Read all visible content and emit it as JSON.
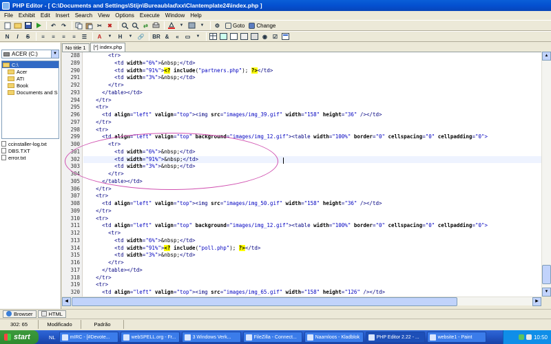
{
  "window": {
    "title": "PHP Editor - [ C:\\Documents and Settings\\Stijn\\Bureaublad\\xx\\Clantemplate24\\index.php ]"
  },
  "menu": [
    "File",
    "Exhibit",
    "Edit",
    "Insert",
    "Search",
    "View",
    "Options",
    "Execute",
    "Window",
    "Help"
  ],
  "toolbar1": {
    "goto_label": "Goto",
    "change_label": "Change"
  },
  "toolbar2": {
    "bold": "N",
    "italic": "I",
    "strike": "S",
    "heading": "H",
    "br": "BR",
    "nbsp": "&"
  },
  "left_panel": {
    "drive": "ACER (C:)",
    "folders": [
      {
        "label": "C:\\",
        "selected": true
      },
      {
        "label": "Acer",
        "selected": false
      },
      {
        "label": "ATI",
        "selected": false
      },
      {
        "label": "Book",
        "selected": false
      },
      {
        "label": "Documents and S",
        "selected": false
      }
    ],
    "files": [
      "ccinstaller-log.txt",
      "DBS.TXT",
      "error.txt"
    ]
  },
  "tabs": [
    {
      "label": "No title 1",
      "active": false
    },
    {
      "label": "[*] index.php",
      "active": true
    }
  ],
  "editor": {
    "current_line": 302,
    "lines": [
      {
        "n": "288",
        "i": 8,
        "p": [
          [
            "tag",
            "<tr>"
          ]
        ]
      },
      {
        "n": "289",
        "i": 10,
        "p": [
          [
            "tag",
            "<td "
          ],
          [
            "attr",
            "width"
          ],
          [
            "tag",
            "="
          ],
          [
            "str",
            "\"6%\""
          ],
          [
            "tag",
            ">"
          ],
          [
            "plain",
            "&nbsp;"
          ],
          [
            "tag",
            "</td>"
          ]
        ]
      },
      {
        "n": "290",
        "i": 10,
        "p": [
          [
            "tag",
            "<td "
          ],
          [
            "attr",
            "width"
          ],
          [
            "tag",
            "="
          ],
          [
            "str",
            "\"91%\""
          ],
          [
            "tag",
            ">"
          ],
          [
            "php",
            "<?"
          ],
          [
            "plain",
            " "
          ],
          [
            "kw",
            "include"
          ],
          [
            "plain",
            "("
          ],
          [
            "str",
            "\"partners.php\""
          ],
          [
            "plain",
            "); "
          ],
          [
            "php",
            "?>"
          ],
          [
            "tag",
            "</td>"
          ]
        ]
      },
      {
        "n": "291",
        "i": 10,
        "p": [
          [
            "tag",
            "<td "
          ],
          [
            "attr",
            "width"
          ],
          [
            "tag",
            "="
          ],
          [
            "str",
            "\"3%\""
          ],
          [
            "tag",
            ">"
          ],
          [
            "plain",
            "&nbsp;"
          ],
          [
            "tag",
            "</td>"
          ]
        ]
      },
      {
        "n": "292",
        "i": 8,
        "p": [
          [
            "tag",
            "</tr>"
          ]
        ]
      },
      {
        "n": "293",
        "i": 6,
        "p": [
          [
            "tag",
            "</table></td>"
          ]
        ]
      },
      {
        "n": "294",
        "i": 4,
        "p": [
          [
            "tag",
            "</tr>"
          ]
        ]
      },
      {
        "n": "295",
        "i": 4,
        "p": [
          [
            "tag",
            "<tr>"
          ]
        ]
      },
      {
        "n": "296",
        "i": 6,
        "p": [
          [
            "tag",
            "<td "
          ],
          [
            "attr",
            "align"
          ],
          [
            "tag",
            "="
          ],
          [
            "str",
            "\"left\""
          ],
          [
            "plain",
            " "
          ],
          [
            "attr",
            "valign"
          ],
          [
            "tag",
            "="
          ],
          [
            "str",
            "\"top\""
          ],
          [
            "tag",
            "><img "
          ],
          [
            "attr",
            "src"
          ],
          [
            "tag",
            "="
          ],
          [
            "str",
            "\"images/img_39.gif\""
          ],
          [
            "plain",
            " "
          ],
          [
            "attr",
            "width"
          ],
          [
            "tag",
            "="
          ],
          [
            "str",
            "\"158\""
          ],
          [
            "plain",
            " "
          ],
          [
            "attr",
            "height"
          ],
          [
            "tag",
            "="
          ],
          [
            "str",
            "\"36\""
          ],
          [
            "tag",
            " /></td>"
          ]
        ]
      },
      {
        "n": "297",
        "i": 4,
        "p": [
          [
            "tag",
            "</tr>"
          ]
        ]
      },
      {
        "n": "298",
        "i": 4,
        "p": [
          [
            "tag",
            "<tr>"
          ]
        ]
      },
      {
        "n": "299",
        "i": 6,
        "p": [
          [
            "tag",
            "<td "
          ],
          [
            "attr",
            "align"
          ],
          [
            "tag",
            "="
          ],
          [
            "str",
            "\"left\""
          ],
          [
            "plain",
            " "
          ],
          [
            "attr",
            "valign"
          ],
          [
            "tag",
            "="
          ],
          [
            "str",
            "\"top\""
          ],
          [
            "plain",
            " "
          ],
          [
            "attr",
            "background"
          ],
          [
            "tag",
            "="
          ],
          [
            "str",
            "\"images/img_12.gif\""
          ],
          [
            "tag",
            "><table "
          ],
          [
            "attr",
            "width"
          ],
          [
            "tag",
            "="
          ],
          [
            "str",
            "\"100%\""
          ],
          [
            "plain",
            " "
          ],
          [
            "attr",
            "border"
          ],
          [
            "tag",
            "="
          ],
          [
            "str",
            "\"0\""
          ],
          [
            "plain",
            " "
          ],
          [
            "attr",
            "cellspacing"
          ],
          [
            "tag",
            "="
          ],
          [
            "str",
            "\"0\""
          ],
          [
            "plain",
            " "
          ],
          [
            "attr",
            "cellpadding"
          ],
          [
            "tag",
            "="
          ],
          [
            "str",
            "\"0\">"
          ]
        ]
      },
      {
        "n": "300",
        "i": 8,
        "p": [
          [
            "tag",
            "<tr>"
          ]
        ]
      },
      {
        "n": "301",
        "i": 10,
        "p": [
          [
            "tag",
            "<td "
          ],
          [
            "attr",
            "width"
          ],
          [
            "tag",
            "="
          ],
          [
            "str",
            "\"6%\""
          ],
          [
            "tag",
            ">"
          ],
          [
            "plain",
            "&nbsp;"
          ],
          [
            "tag",
            "</td>"
          ]
        ]
      },
      {
        "n": "302",
        "i": 10,
        "p": [
          [
            "tag",
            "<td "
          ],
          [
            "attr",
            "width"
          ],
          [
            "tag",
            "="
          ],
          [
            "str",
            "\"91%\""
          ],
          [
            "tag",
            ">"
          ],
          [
            "plain",
            "&nbsp;"
          ],
          [
            "tag",
            "</td>"
          ]
        ]
      },
      {
        "n": "303",
        "i": 10,
        "p": [
          [
            "tag",
            "<td "
          ],
          [
            "attr",
            "width"
          ],
          [
            "tag",
            "="
          ],
          [
            "str",
            "\"3%\""
          ],
          [
            "tag",
            ">"
          ],
          [
            "plain",
            "&nbsp;"
          ],
          [
            "tag",
            "</td>"
          ]
        ]
      },
      {
        "n": "304",
        "i": 8,
        "p": [
          [
            "tag",
            "</tr>"
          ]
        ]
      },
      {
        "n": "305",
        "i": 6,
        "p": [
          [
            "tag",
            "</table></td>"
          ]
        ]
      },
      {
        "n": "306",
        "i": 4,
        "p": [
          [
            "tag",
            "</tr>"
          ]
        ]
      },
      {
        "n": "307",
        "i": 4,
        "p": [
          [
            "tag",
            "<tr>"
          ]
        ]
      },
      {
        "n": "308",
        "i": 6,
        "p": [
          [
            "tag",
            "<td "
          ],
          [
            "attr",
            "align"
          ],
          [
            "tag",
            "="
          ],
          [
            "str",
            "\"left\""
          ],
          [
            "plain",
            " "
          ],
          [
            "attr",
            "valign"
          ],
          [
            "tag",
            "="
          ],
          [
            "str",
            "\"top\""
          ],
          [
            "tag",
            "><img "
          ],
          [
            "attr",
            "src"
          ],
          [
            "tag",
            "="
          ],
          [
            "str",
            "\"images/img_50.gif\""
          ],
          [
            "plain",
            " "
          ],
          [
            "attr",
            "width"
          ],
          [
            "tag",
            "="
          ],
          [
            "str",
            "\"158\""
          ],
          [
            "plain",
            " "
          ],
          [
            "attr",
            "height"
          ],
          [
            "tag",
            "="
          ],
          [
            "str",
            "\"36\""
          ],
          [
            "tag",
            " /></td>"
          ]
        ]
      },
      {
        "n": "309",
        "i": 4,
        "p": [
          [
            "tag",
            "</tr>"
          ]
        ]
      },
      {
        "n": "310",
        "i": 4,
        "p": [
          [
            "tag",
            "<tr>"
          ]
        ]
      },
      {
        "n": "311",
        "i": 6,
        "p": [
          [
            "tag",
            "<td "
          ],
          [
            "attr",
            "align"
          ],
          [
            "tag",
            "="
          ],
          [
            "str",
            "\"left\""
          ],
          [
            "plain",
            " "
          ],
          [
            "attr",
            "valign"
          ],
          [
            "tag",
            "="
          ],
          [
            "str",
            "\"top\""
          ],
          [
            "plain",
            " "
          ],
          [
            "attr",
            "background"
          ],
          [
            "tag",
            "="
          ],
          [
            "str",
            "\"images/img_12.gif\""
          ],
          [
            "tag",
            "><table "
          ],
          [
            "attr",
            "width"
          ],
          [
            "tag",
            "="
          ],
          [
            "str",
            "\"100%\""
          ],
          [
            "plain",
            " "
          ],
          [
            "attr",
            "border"
          ],
          [
            "tag",
            "="
          ],
          [
            "str",
            "\"0\""
          ],
          [
            "plain",
            " "
          ],
          [
            "attr",
            "cellspacing"
          ],
          [
            "tag",
            "="
          ],
          [
            "str",
            "\"0\""
          ],
          [
            "plain",
            " "
          ],
          [
            "attr",
            "cellpadding"
          ],
          [
            "tag",
            "="
          ],
          [
            "str",
            "\"0\">"
          ]
        ]
      },
      {
        "n": "312",
        "i": 8,
        "p": [
          [
            "tag",
            "<tr>"
          ]
        ]
      },
      {
        "n": "313",
        "i": 10,
        "p": [
          [
            "tag",
            "<td "
          ],
          [
            "attr",
            "width"
          ],
          [
            "tag",
            "="
          ],
          [
            "str",
            "\"6%\""
          ],
          [
            "tag",
            ">"
          ],
          [
            "plain",
            "&nbsp;"
          ],
          [
            "tag",
            "</td>"
          ]
        ]
      },
      {
        "n": "314",
        "i": 10,
        "p": [
          [
            "tag",
            "<td "
          ],
          [
            "attr",
            "width"
          ],
          [
            "tag",
            "="
          ],
          [
            "str",
            "\"91%\""
          ],
          [
            "tag",
            ">"
          ],
          [
            "php",
            "<?"
          ],
          [
            "plain",
            " "
          ],
          [
            "kw",
            "include"
          ],
          [
            "plain",
            "("
          ],
          [
            "str",
            "\"poll.php\""
          ],
          [
            "plain",
            "); "
          ],
          [
            "php",
            "?>"
          ],
          [
            "tag",
            "</td>"
          ]
        ]
      },
      {
        "n": "315",
        "i": 10,
        "p": [
          [
            "tag",
            "<td "
          ],
          [
            "attr",
            "width"
          ],
          [
            "tag",
            "="
          ],
          [
            "str",
            "\"3%\""
          ],
          [
            "tag",
            ">"
          ],
          [
            "plain",
            "&nbsp;"
          ],
          [
            "tag",
            "</td>"
          ]
        ]
      },
      {
        "n": "316",
        "i": 8,
        "p": [
          [
            "tag",
            "</tr>"
          ]
        ]
      },
      {
        "n": "317",
        "i": 6,
        "p": [
          [
            "tag",
            "</table></td>"
          ]
        ]
      },
      {
        "n": "318",
        "i": 4,
        "p": [
          [
            "tag",
            "</tr>"
          ]
        ]
      },
      {
        "n": "319",
        "i": 4,
        "p": [
          [
            "tag",
            "<tr>"
          ]
        ]
      },
      {
        "n": "320",
        "i": 6,
        "p": [
          [
            "tag",
            "<td "
          ],
          [
            "attr",
            "align"
          ],
          [
            "tag",
            "="
          ],
          [
            "str",
            "\"left\""
          ],
          [
            "plain",
            " "
          ],
          [
            "attr",
            "valign"
          ],
          [
            "tag",
            "="
          ],
          [
            "str",
            "\"top\""
          ],
          [
            "tag",
            "><img "
          ],
          [
            "attr",
            "src"
          ],
          [
            "tag",
            "="
          ],
          [
            "str",
            "\"images/img_65.gif\""
          ],
          [
            "plain",
            " "
          ],
          [
            "attr",
            "width"
          ],
          [
            "tag",
            "="
          ],
          [
            "str",
            "\"158\""
          ],
          [
            "plain",
            " "
          ],
          [
            "attr",
            "height"
          ],
          [
            "tag",
            "="
          ],
          [
            "str",
            "\"126\""
          ],
          [
            "tag",
            " /></td>"
          ]
        ]
      }
    ]
  },
  "bottom_tabs": {
    "browser": "Browser",
    "html": "HTML"
  },
  "status": {
    "position": "302: 65",
    "modified": "Modificado",
    "mode": "Padrão"
  },
  "taskbar": {
    "start": "start",
    "lang": "NL",
    "tasks": [
      {
        "label": "mIRC - [#Devote...",
        "active": false
      },
      {
        "label": "webSPELL.org - Fr...",
        "active": false
      },
      {
        "label": "3 Windows Verk...",
        "active": false
      },
      {
        "label": "FileZilla - Connect...",
        "active": false
      },
      {
        "label": "Naamloos - Kladblok",
        "active": false
      },
      {
        "label": "PHP Editor 2.22 - ...",
        "active": true
      },
      {
        "label": "website1 - Paint",
        "active": false
      }
    ],
    "clock": "10:50"
  },
  "colors": {
    "tag": "#000080",
    "string": "#0000c0",
    "php_highlight": "#ffff00",
    "annotation": "#d050b0"
  }
}
